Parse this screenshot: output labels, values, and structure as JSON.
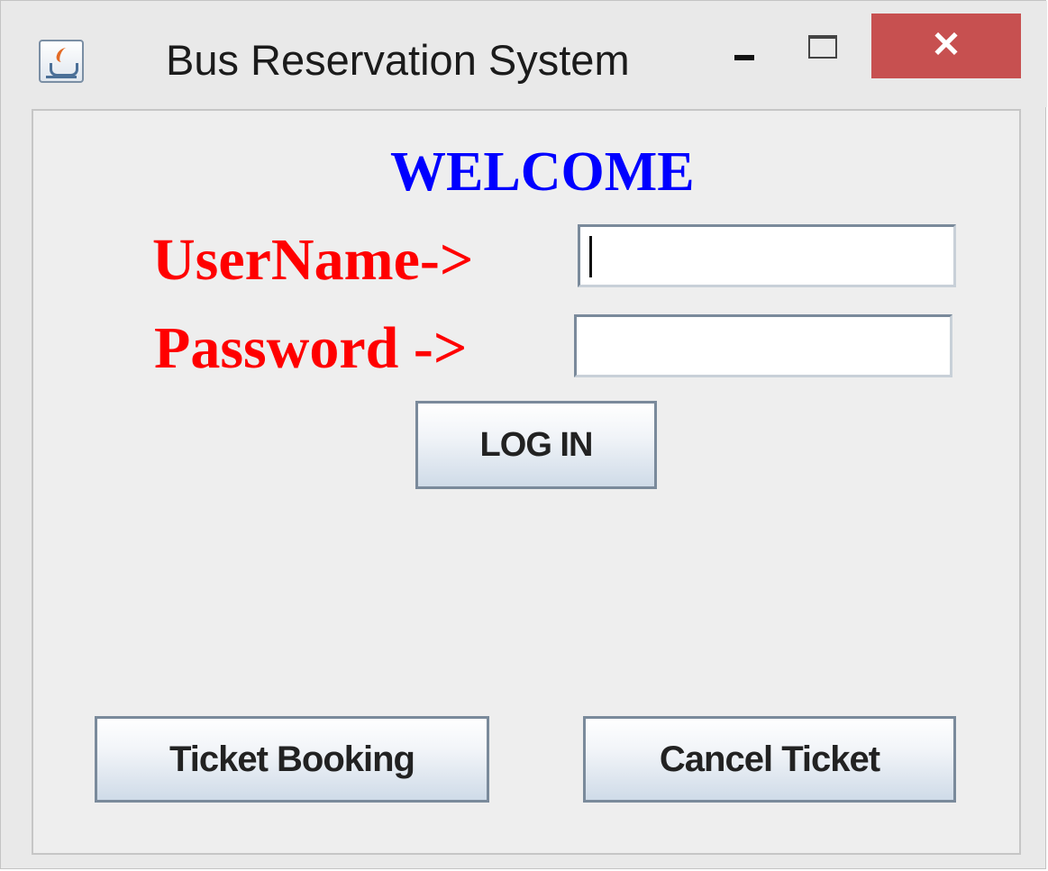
{
  "window": {
    "title": "Bus Reservation System",
    "icon": "java-cup-icon",
    "controls": {
      "minimize_icon": "minimize-icon",
      "maximize_icon": "maximize-icon",
      "close_label": "✕",
      "close_color": "#c75050"
    }
  },
  "main": {
    "welcome": "WELCOME",
    "welcome_color": "#0000ff",
    "label_color": "#ff0000",
    "username_label": "UserName->",
    "username_value": "",
    "password_label": "Password ->",
    "password_value": "",
    "login_button": "LOG IN",
    "ticket_booking_button": "Ticket Booking",
    "cancel_ticket_button": "Cancel Ticket"
  }
}
